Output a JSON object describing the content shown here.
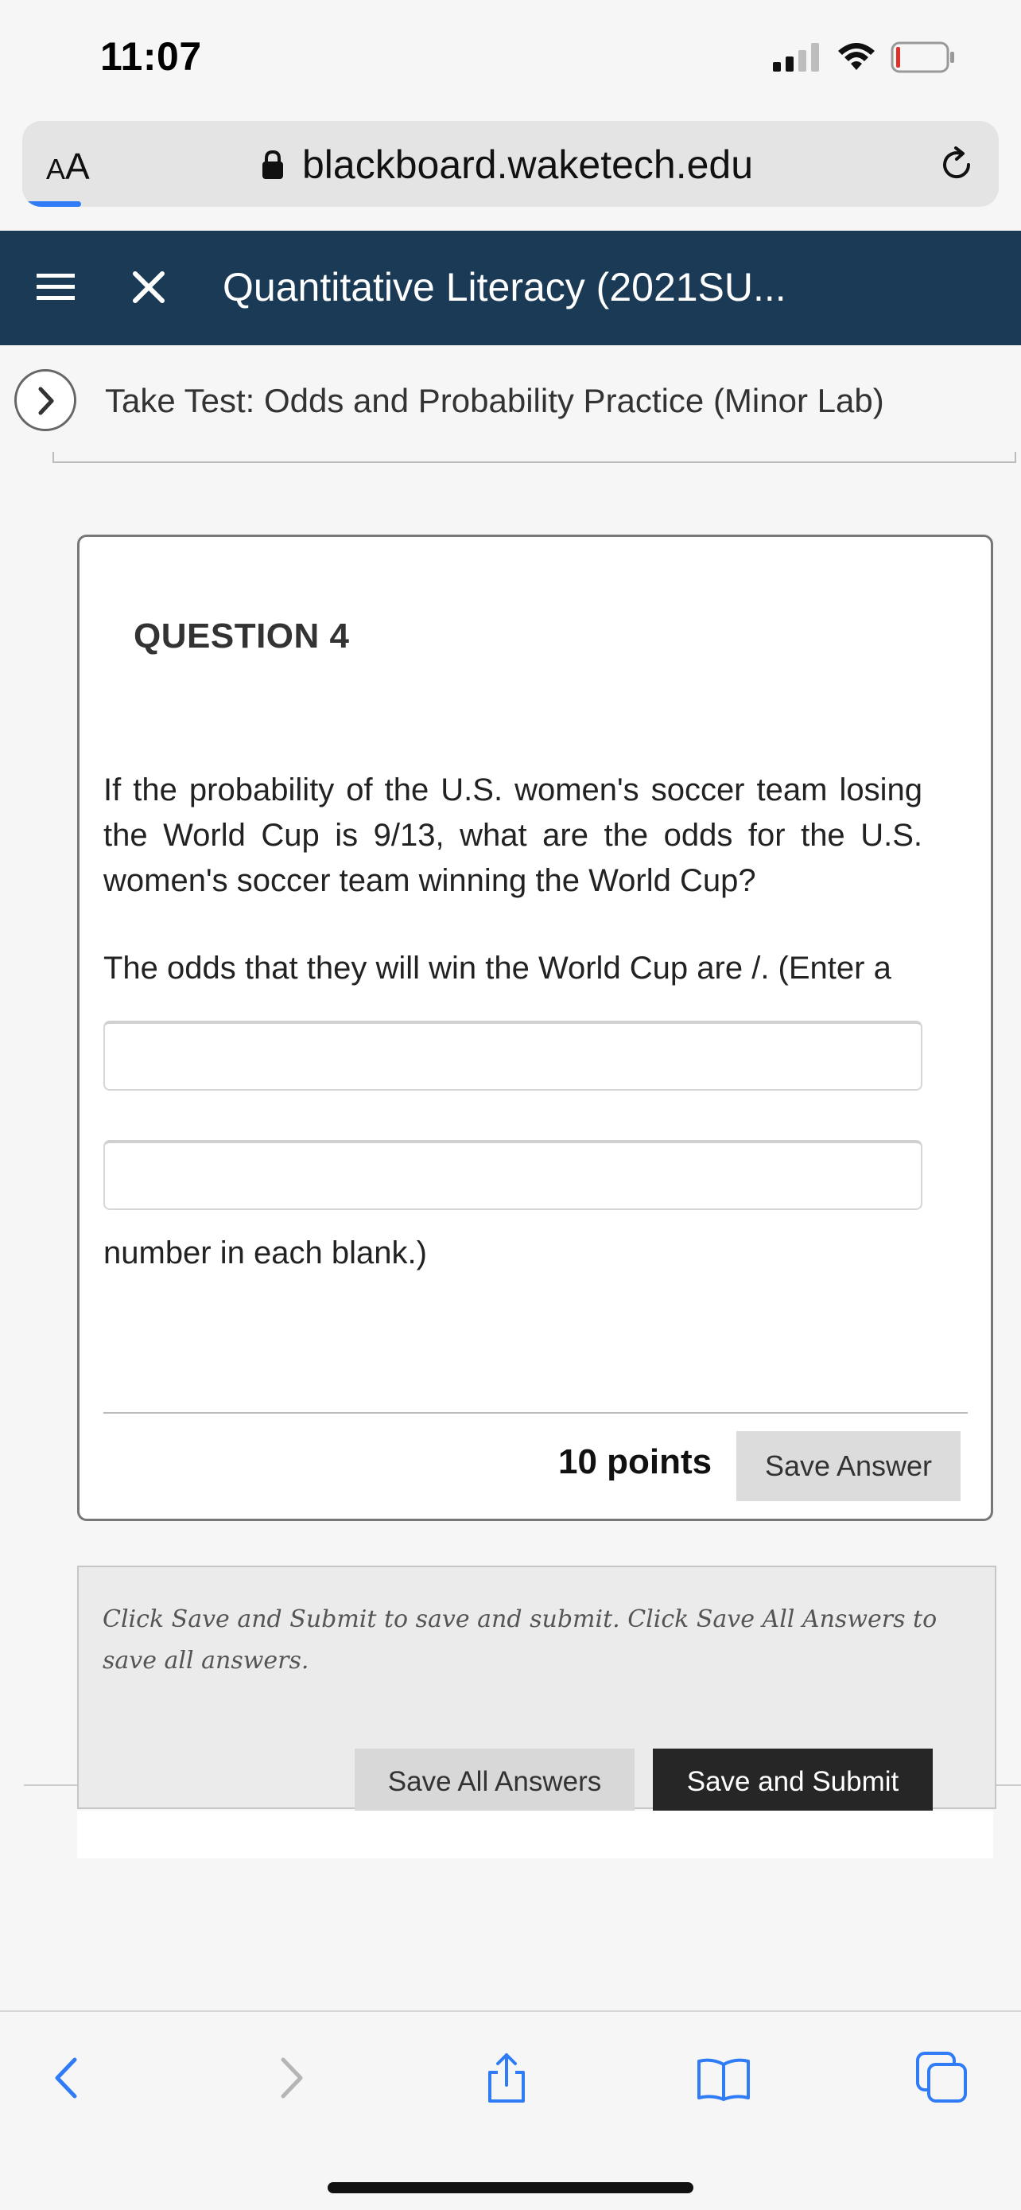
{
  "status_bar": {
    "time": "11:07"
  },
  "browser": {
    "aa_label_large": "A",
    "aa_label_small": "A",
    "url": "blackboard.waketech.edu",
    "load_progress": 0.06
  },
  "course_header": {
    "title": "Quantitative Literacy (2021SU..."
  },
  "page_header": {
    "title": "Take Test: Odds and Probability Practice (Minor Lab)"
  },
  "question": {
    "label": "QUESTION 4",
    "text": "If the probability of the U.S. women's soccer team losing the World Cup is 9/13, what are the odds for the U.S. women's soccer team winning the World Cup?",
    "answer_lead": "The odds that they will win the World Cup are /. (Enter a",
    "answer_1_value": "",
    "answer_2_value": "",
    "answer_tail": "number in each blank.)",
    "points": "10 points",
    "save_answer_label": "Save Answer"
  },
  "submit_panel": {
    "info": "Click Save and Submit to save and submit. Click Save All Answers to save all answers.",
    "save_all_label": "Save All Answers",
    "save_submit_label": "Save and Submit"
  },
  "toolbar": {
    "items": [
      "back-icon",
      "forward-icon",
      "share-icon",
      "bookmarks-icon",
      "tabs-icon"
    ],
    "accent_color": "#2f7cf6",
    "disabled_color": "#b5b5b5"
  }
}
